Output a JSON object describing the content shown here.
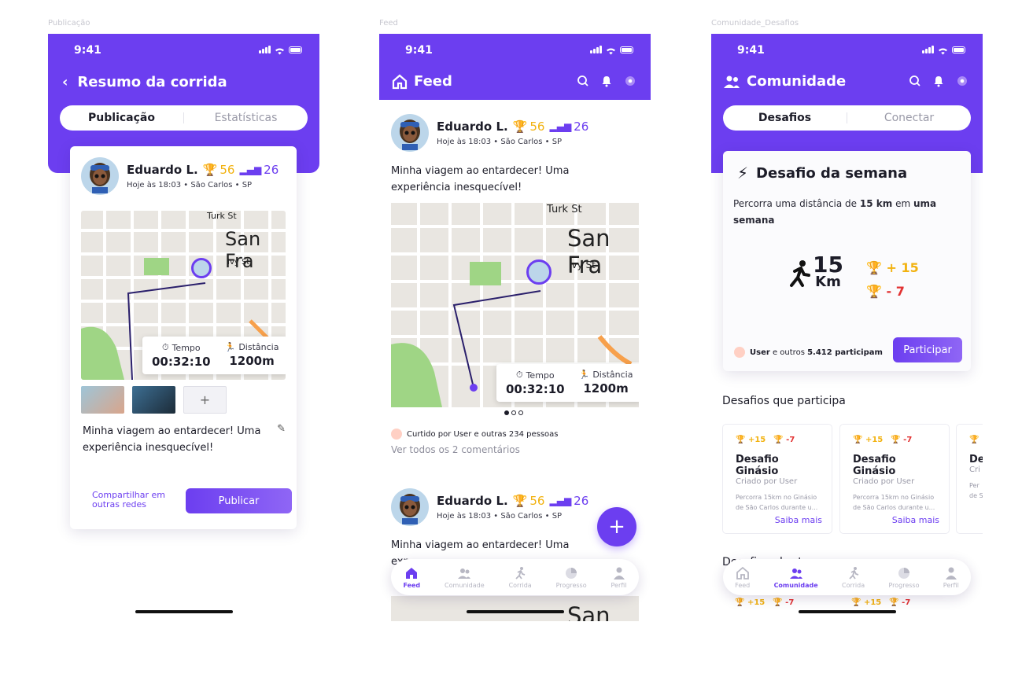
{
  "frames": {
    "publicacao": "Publicação",
    "feed": "Feed",
    "comunidade": "Comunidade_Desafios"
  },
  "status_time": "9:41",
  "post": {
    "user": "Eduardo L.",
    "score": "56",
    "level": "26",
    "meta": "Hoje às 18:03 • São Carlos • SP",
    "text_line1": "Minha viagem ao entardecer! Uma",
    "text_line2": "experiência inesquecível!",
    "map_city": "San Fra",
    "map_street1": "Turk St",
    "map_street2": "Ivy St",
    "time_label": "Tempo",
    "time_value": "00:32:10",
    "distance_label": "Distância",
    "distance_value": "1200m"
  },
  "screen1": {
    "title": "Resumo da corrida",
    "tab_active": "Publicação",
    "tab_inactive": "Estatísticas",
    "share_line1": "Compartilhar em",
    "share_line2": "outras redes",
    "publish": "Publicar"
  },
  "screen2": {
    "title": "Feed",
    "likes": "Curtido por User e outras 234 pessoas",
    "comments": "Ver todos os 2 comentários",
    "partial_text": "exp"
  },
  "screen3": {
    "title": "Comunidade",
    "tab_active": "Desafios",
    "tab_inactive": "Conectar",
    "weekly_title": "Desafio da semana",
    "weekly_desc_a": "Percorra uma distância de ",
    "weekly_desc_b": "15 km",
    "weekly_desc_c": " em ",
    "weekly_desc_d": "uma",
    "weekly_desc_e": "semana",
    "distance_num": "15",
    "distance_unit": "Km",
    "gain": "+ 15",
    "loss": "- 7",
    "participants_user": "User",
    "participants_mid": " e outros ",
    "participants_count": "5.412 participam",
    "join": "Participar",
    "section": "Desafios que participa",
    "section2_partial": "Desafios abertos",
    "cards": [
      {
        "gain": "+15",
        "loss": "-7",
        "title": "Desafio Ginásio",
        "by": "Criado por User",
        "desc1": "Percorra 15km no Ginásio",
        "desc2": "de São Carlos durante u...",
        "more": "Saiba mais"
      },
      {
        "gain": "+15",
        "loss": "-7",
        "title": "Desafio Ginásio",
        "by": "Criado por User",
        "desc1": "Percorra 15km no Ginásio",
        "desc2": "de São Carlos durante u...",
        "more": "Saiba mais"
      },
      {
        "gain": "+",
        "loss": "",
        "title": "De",
        "by": "Cri",
        "desc1": "Per",
        "desc2": "de S",
        "more": ""
      }
    ]
  },
  "nav": {
    "feed": "Feed",
    "comunidade": "Comunidade",
    "corrida": "Corrida",
    "progresso": "Progresso",
    "perfil": "Perfil"
  },
  "colors": {
    "accent": "#6c3ef0",
    "gold": "#f2b210",
    "red": "#e23232"
  }
}
